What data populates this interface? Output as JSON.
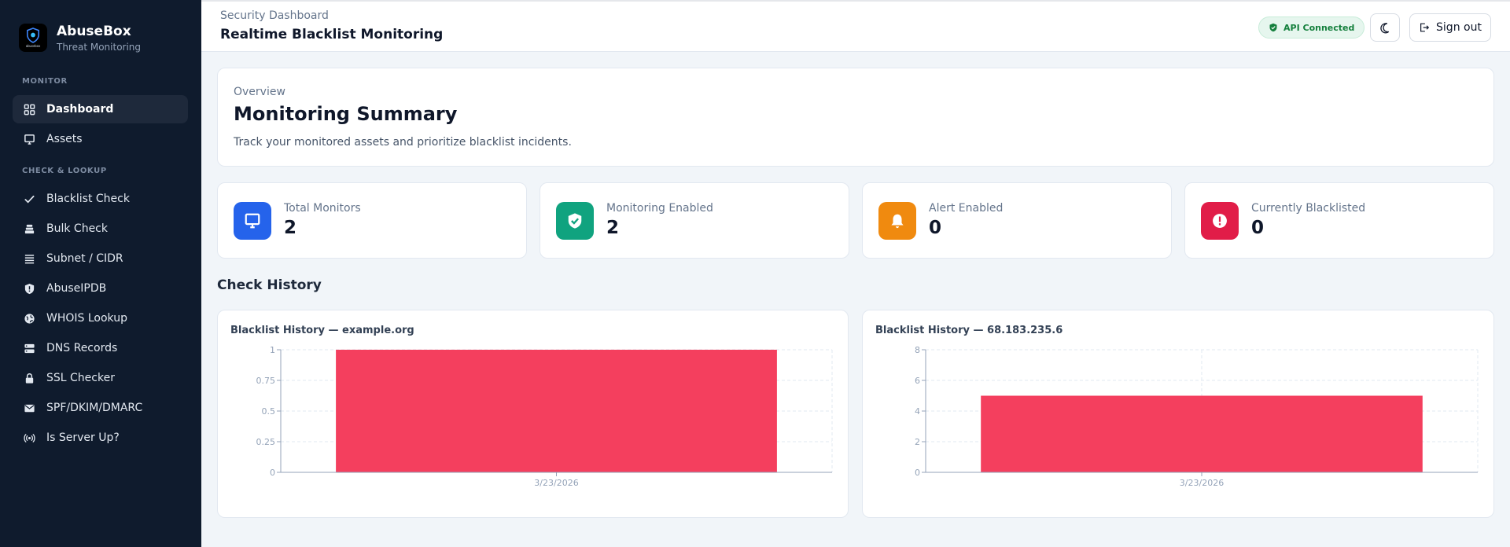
{
  "brand": {
    "name": "AbuseBox",
    "subtitle": "Threat Monitoring",
    "logo_text": "abusebox"
  },
  "sidebar": {
    "sections": [
      {
        "label": "MONITOR"
      },
      {
        "label": "CHECK & LOOKUP"
      }
    ],
    "items": [
      {
        "label": "Dashboard",
        "icon": "grid-icon",
        "active": true
      },
      {
        "label": "Assets",
        "icon": "monitor-icon"
      },
      {
        "label": "Blacklist Check",
        "icon": "check-icon"
      },
      {
        "label": "Bulk Check",
        "icon": "layers-icon"
      },
      {
        "label": "Subnet / CIDR",
        "icon": "list-icon"
      },
      {
        "label": "AbuseIPDB",
        "icon": "shield-icon"
      },
      {
        "label": "WHOIS Lookup",
        "icon": "globe-icon"
      },
      {
        "label": "DNS Records",
        "icon": "server-icon"
      },
      {
        "label": "SSL Checker",
        "icon": "lock-icon"
      },
      {
        "label": "SPF/DKIM/DMARC",
        "icon": "mail-icon"
      },
      {
        "label": "Is Server Up?",
        "icon": "broadcast-icon"
      }
    ]
  },
  "header": {
    "breadcrumb": "Security Dashboard",
    "title": "Realtime Blacklist Monitoring",
    "api_status": "API Connected",
    "signout_label": "Sign out"
  },
  "overview": {
    "label": "Overview",
    "title": "Monitoring Summary",
    "description": "Track your monitored assets and prioritize blacklist incidents."
  },
  "stats": [
    {
      "label": "Total Monitors",
      "value": "2",
      "color": "#2563eb",
      "icon": "monitor-icon"
    },
    {
      "label": "Monitoring Enabled",
      "value": "2",
      "color": "#10a37f",
      "icon": "shield-check-icon"
    },
    {
      "label": "Alert Enabled",
      "value": "0",
      "color": "#f08a0f",
      "icon": "bell-icon"
    },
    {
      "label": "Currently Blacklisted",
      "value": "0",
      "color": "#e11d48",
      "icon": "alert-icon"
    }
  ],
  "history": {
    "title": "Check History"
  },
  "chart_data": [
    {
      "type": "bar",
      "title": "Blacklist History — example.org",
      "categories": [
        "3/23/2026"
      ],
      "values": [
        1
      ],
      "ylim": [
        0,
        1
      ],
      "yticks": [
        "0",
        "0.25",
        "0.5",
        "0.75",
        "1"
      ],
      "bar_color": "#f43f5e",
      "grid": true
    },
    {
      "type": "bar",
      "title": "Blacklist History — 68.183.235.6",
      "categories": [
        "3/23/2026"
      ],
      "values": [
        5
      ],
      "ylim": [
        0,
        8
      ],
      "yticks": [
        "0",
        "2",
        "4",
        "6",
        "8"
      ],
      "bar_color": "#f43f5e",
      "grid": true
    }
  ]
}
